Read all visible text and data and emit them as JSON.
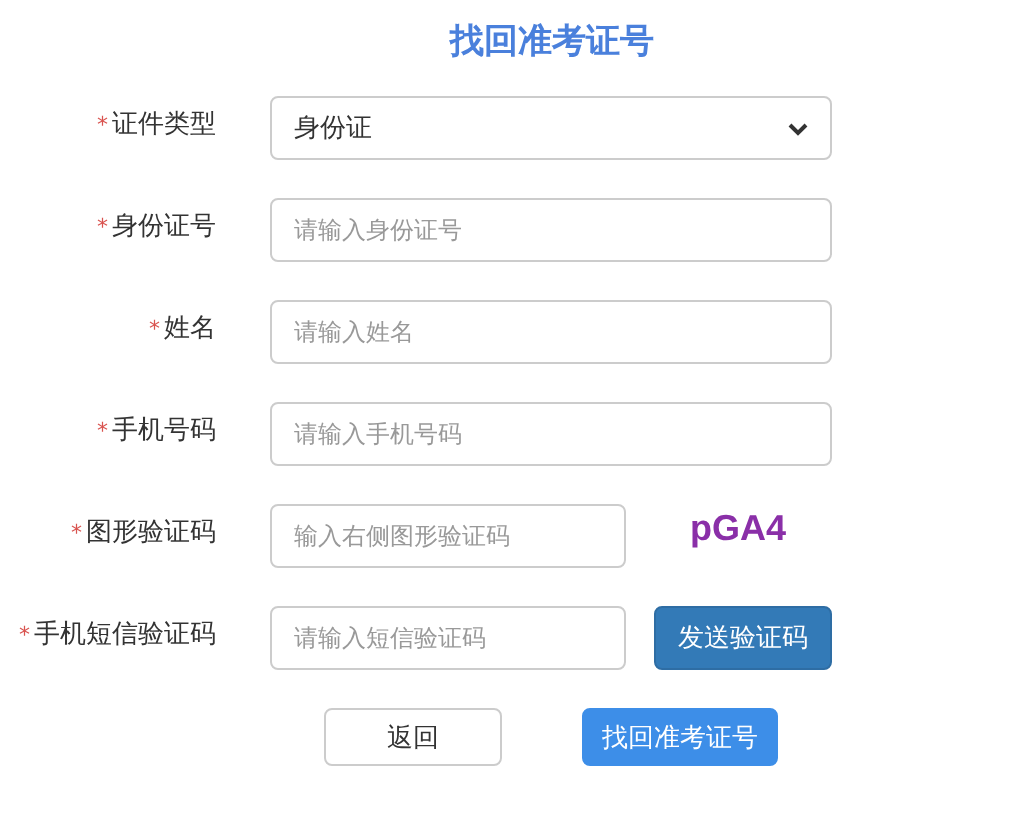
{
  "title": "找回准考证号",
  "fields": [
    {
      "kind": "select",
      "mark": "*",
      "label": "证件类型",
      "value": "身份证"
    },
    {
      "kind": "input",
      "mark": "*",
      "label": "身份证号",
      "placeholder": "请输入身份证号"
    },
    {
      "kind": "input",
      "mark": "*",
      "label": "姓名",
      "placeholder": "请输入姓名"
    },
    {
      "kind": "input",
      "mark": "*",
      "label": "手机号码",
      "placeholder": "请输入手机号码"
    },
    {
      "kind": "captcha",
      "mark": "*",
      "label": "图形验证码",
      "placeholder": "输入右侧图形验证码",
      "captcha": "pGA4"
    },
    {
      "kind": "sms",
      "mark": "*",
      "label": "手机短信验证码",
      "placeholder": "请输入短信验证码",
      "button": "发送验证码"
    }
  ],
  "buttons": [
    {
      "kind": "default",
      "label": "返回"
    },
    {
      "kind": "primary",
      "label": "找回准考证号"
    }
  ]
}
